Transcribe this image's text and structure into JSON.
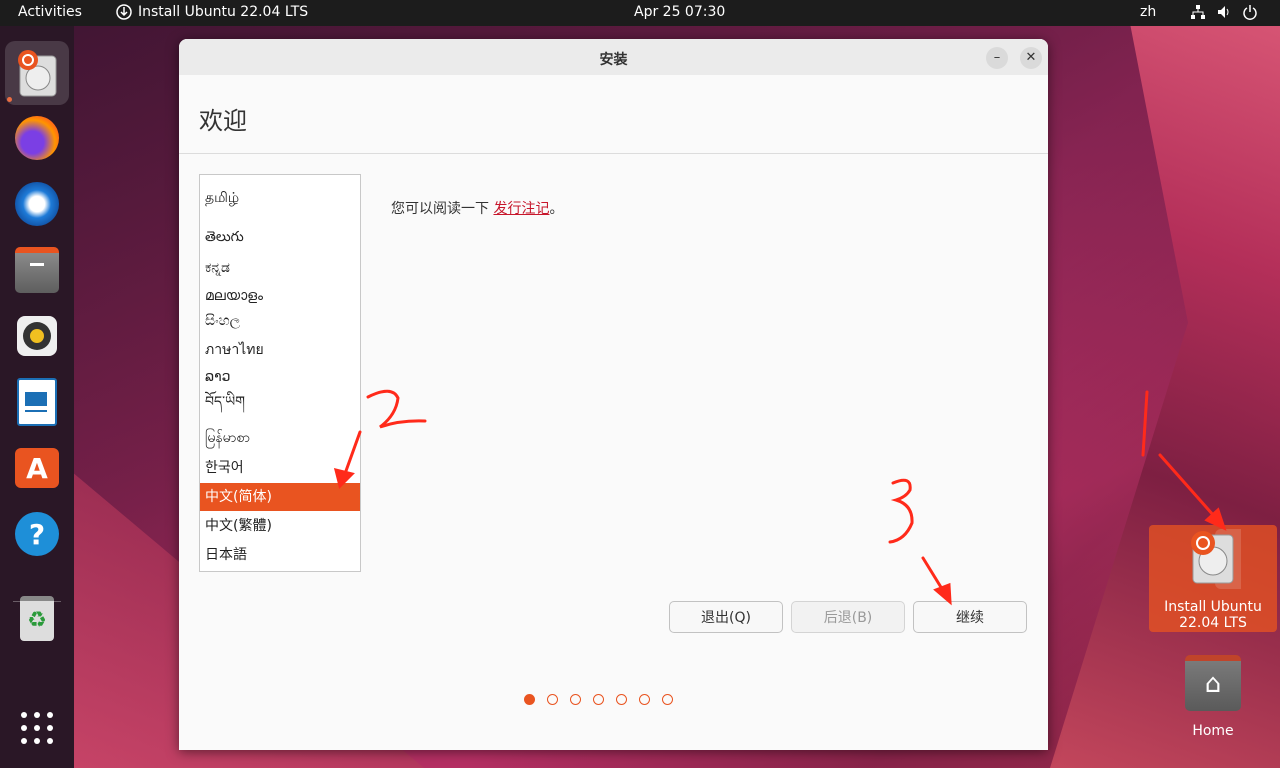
{
  "topbar": {
    "activities": "Activities",
    "app_name": "Install Ubuntu 22.04 LTS",
    "clock": "Apr 25  07:30",
    "lang": "zh"
  },
  "dock": {
    "items": [
      "ubuntu-installer",
      "firefox",
      "thunderbird",
      "files",
      "rhythmbox",
      "libreoffice-writer",
      "app-center",
      "help",
      "trash",
      "show-apps"
    ]
  },
  "window": {
    "title": "安装",
    "heading": "欢迎",
    "read_prefix": "您可以阅读一下 ",
    "release_notes_link": "发行注记",
    "read_suffix": "。",
    "languages": [
      "தமிழ்",
      "తెలుగు",
      "ಕನ್ನಡ",
      "മലയാളം",
      "සිංහල",
      "ภาษาไทย",
      "ລາວ",
      "བོད་ཡིག",
      "မြန်မာစာ",
      "한국어",
      "中文(简体)",
      "中文(繁體)",
      "日本語"
    ],
    "selected_language": "中文(简体)",
    "buttons": {
      "quit": "退出(Q)",
      "back": "后退(B)",
      "continue": "继续"
    },
    "progress": {
      "current_step": 1,
      "total_steps": 7
    }
  },
  "desktop": {
    "installer_label": "Install Ubuntu\n22.04 LTS",
    "installer_line1": "Install Ubuntu",
    "installer_line2": "22.04 LTS",
    "home_label": "Home"
  },
  "annotations": [
    "1",
    "2",
    "3"
  ],
  "colors": {
    "accent": "#e95420",
    "annotation": "#ff2a1a"
  }
}
